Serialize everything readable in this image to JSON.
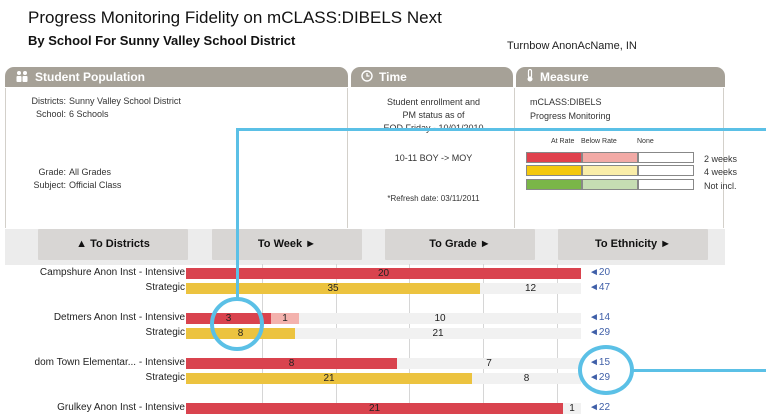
{
  "header": {
    "title": "Progress Monitoring Fidelity on mCLASS:DIBELS Next",
    "subtitle": "By School For Sunny Valley School District",
    "user": "Turnbow AnonAcName, IN"
  },
  "panels": {
    "population": {
      "title": "Student Population",
      "rows": [
        {
          "label": "Districts:",
          "value": "Sunny Valley School District"
        },
        {
          "label": "School:",
          "value": "6 Schools"
        },
        {
          "label": "Grade:",
          "value": "All Grades"
        },
        {
          "label": "Subject:",
          "value": "Official Class"
        }
      ]
    },
    "time": {
      "title": "Time",
      "lines": [
        "Student enrollment and",
        "PM status as of",
        "EOD Friday - 10/01/2010"
      ],
      "period": "10-11 BOY -> MOY",
      "refresh": "*Refresh date: 03/11/2011"
    },
    "measure": {
      "title": "Measure",
      "name": "mCLASS:DIBELS",
      "type": "Progress Monitoring",
      "legend": {
        "columns": [
          "At Rate",
          "Below Rate",
          "None"
        ],
        "rows": [
          "2 weeks",
          "4 weeks",
          "Not incl."
        ],
        "colors": [
          [
            "#e0414d",
            "#f2aaa6",
            "#ffffff"
          ],
          [
            "#f4c80e",
            "#faeda8",
            "#ffffff"
          ],
          [
            "#7ab648",
            "#c6ddb3",
            "#ffffff"
          ]
        ]
      }
    }
  },
  "nav": {
    "districts": "▲ To Districts",
    "week": "To Week ►",
    "grade": "To Grade ►",
    "ethnicity": "To Ethnicity ►"
  },
  "chart_data": {
    "type": "bar",
    "stacked": true,
    "orientation": "horizontal",
    "colors": {
      "intensive": "#d9434e",
      "strategic": "#ecc33f",
      "below": "#f3b2ad",
      "none": "#f1f1f1"
    },
    "rows": [
      {
        "label": "Campshure Anon Inst - Intensive",
        "total": "◄20",
        "segments": [
          {
            "value": 20,
            "color": "intensive",
            "label": "20"
          }
        ]
      },
      {
        "label": "Strategic",
        "total": "◄47",
        "segments": [
          {
            "value": 35,
            "color": "strategic",
            "label": "35"
          },
          {
            "value": 12,
            "color": "none",
            "label": "12"
          }
        ]
      },
      {
        "label": "Detmers Anon Inst - Intensive",
        "total": "◄14",
        "segments": [
          {
            "value": 3,
            "color": "intensive",
            "label": "3"
          },
          {
            "value": 1,
            "color": "below",
            "label": "1"
          },
          {
            "value": 10,
            "color": "none",
            "label": "10"
          }
        ]
      },
      {
        "label": "Strategic",
        "total": "◄29",
        "segments": [
          {
            "value": 8,
            "color": "strategic",
            "label": "8"
          },
          {
            "value": 21,
            "color": "none",
            "label": "21"
          }
        ]
      },
      {
        "label": "dom Town Elementar... - Intensive",
        "total": "◄15",
        "segments": [
          {
            "value": 8,
            "color": "intensive",
            "label": "8"
          },
          {
            "value": 7,
            "color": "none",
            "label": "7"
          }
        ]
      },
      {
        "label": "Strategic",
        "total": "◄29",
        "segments": [
          {
            "value": 21,
            "color": "strategic",
            "label": "21"
          },
          {
            "value": 8,
            "color": "none",
            "label": "8"
          }
        ]
      },
      {
        "label": "Grulkey Anon Inst - Intensive",
        "total": "◄22",
        "segments": [
          {
            "value": 21,
            "color": "intensive",
            "label": "21"
          },
          {
            "value": 1,
            "color": "none",
            "label": "1"
          }
        ]
      }
    ]
  }
}
